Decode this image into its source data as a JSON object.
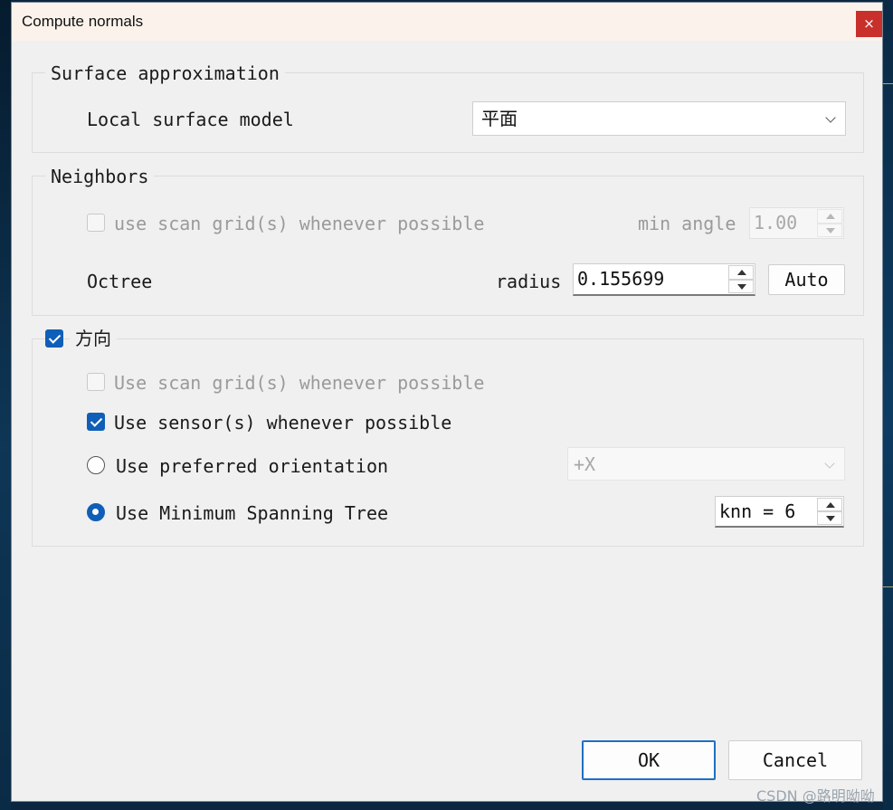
{
  "window": {
    "title": "Compute normals",
    "close_symbol": "×"
  },
  "surface_approximation": {
    "legend": "Surface approximation",
    "local_surface_model_label": "Local surface model",
    "local_surface_model_value": "平面"
  },
  "neighbors": {
    "legend": "Neighbors",
    "use_scan_grid_label": "use scan grid(s) whenever possible",
    "use_scan_grid_checked": false,
    "min_angle_label": "min angle",
    "min_angle_value": "1.00",
    "octree_label": "Octree",
    "radius_label": "radius",
    "radius_value": "0.155699",
    "auto_button": "Auto"
  },
  "orientation": {
    "legend": "方向",
    "enabled": true,
    "use_scan_grid_label": "Use scan grid(s) whenever possible",
    "use_scan_grid_checked": false,
    "use_sensor_label": "Use sensor(s) whenever possible",
    "use_sensor_checked": true,
    "use_preferred_label": "Use preferred orientation",
    "use_preferred_selected": false,
    "preferred_value": "+X",
    "use_mst_label": "Use Minimum Spanning Tree",
    "use_mst_selected": true,
    "knn_value": "knn = 6"
  },
  "footer": {
    "ok_button": "OK",
    "cancel_button": "Cancel"
  },
  "watermark": "CSDN @路明呦呦",
  "colors": {
    "accent": "#0f5fb8",
    "close_button": "#c9302c",
    "dialog_background": "#f0f0f0",
    "titlebar_background": "#fbf3eb"
  }
}
